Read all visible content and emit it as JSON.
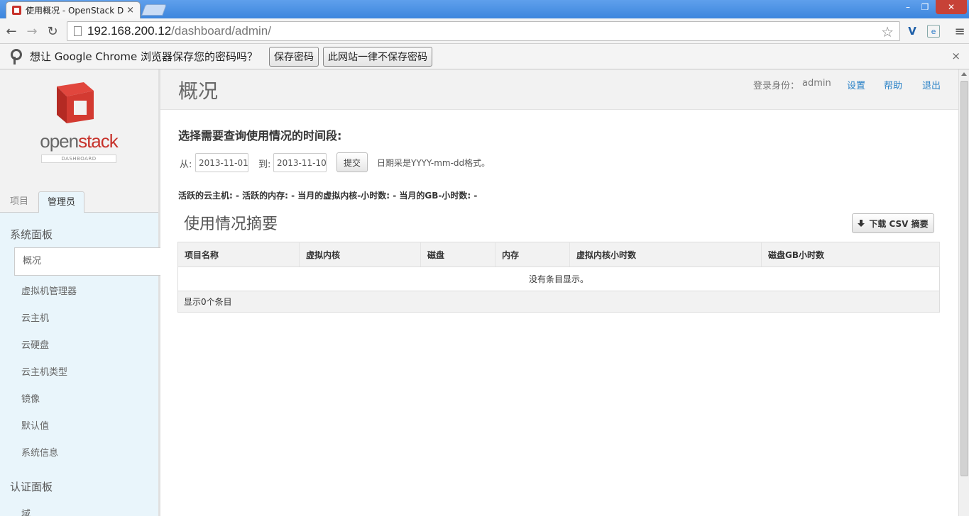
{
  "browser": {
    "tab_title": "使用概况 - OpenStack D",
    "tab_close": "×",
    "url_host": "192.168.200.12",
    "url_path": "/dashboard/admin/",
    "infobar_text": "想让 Google Chrome 浏览器保存您的密码吗？",
    "save_password": "保存密码",
    "never_save": "此网站一律不保存密码",
    "infobar_close": "×"
  },
  "logo": {
    "word_a": "open",
    "word_b": "stack",
    "sub": "DASHBOARD"
  },
  "sidebar": {
    "tabs": [
      "项目",
      "管理员"
    ],
    "system_panel": "系统面板",
    "items": [
      "概况",
      "虚拟机管理器",
      "云主机",
      "云硬盘",
      "云主机类型",
      "镜像",
      "默认值",
      "系统信息"
    ],
    "auth_panel": "认证面板",
    "auth_items": [
      "域"
    ]
  },
  "header": {
    "title": "概况",
    "login_label": "登录身份：",
    "username": "admin",
    "settings": "设置",
    "help": "帮助",
    "logout": "退出"
  },
  "form": {
    "title": "选择需要查询使用情况的时间段:",
    "from_label": "从:",
    "from_value": "2013-11-01",
    "to_label": "到:",
    "to_value": "2013-11-10",
    "submit": "提交",
    "hint": "日期采是YYYY-mm-dd格式。"
  },
  "stats": "活跃的云主机: - 活跃的内存: - 当月的虚拟内核-小时数: - 当月的GB-小时数: -",
  "summary": {
    "title": "使用情况摘要",
    "csv_button": "下载 CSV 摘要",
    "columns": [
      "项目名称",
      "虚拟内核",
      "磁盘",
      "内存",
      "虚拟内核小时数",
      "磁盘GB小时数"
    ],
    "empty_text": "没有条目显示。",
    "footer": "显示0个条目"
  },
  "colors": {
    "accent_link": "#2a82c7",
    "brand_red": "#c7322b",
    "panel_bg": "#e9f5fb"
  }
}
